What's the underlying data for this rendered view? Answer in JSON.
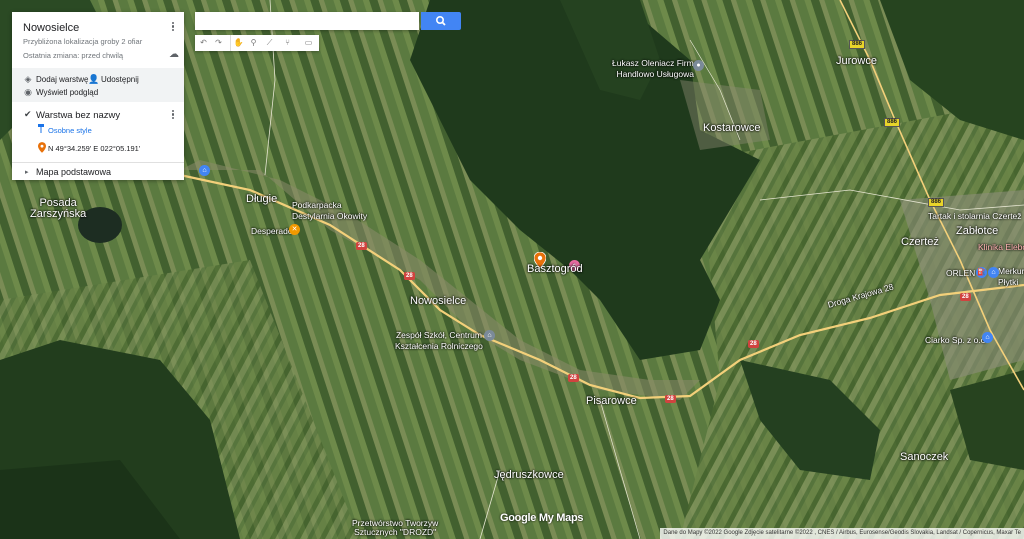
{
  "panel": {
    "title": "Nowosielce",
    "description": "Przybliżona lokalizacja groby 2 ofiar",
    "last_change": "Ostatnia zmiana: przed chwilą",
    "add_layer": "Dodaj warstwę",
    "share": "Udostępnij",
    "preview": "Wyświetl podgląd",
    "layer_name": "Warstwa bez nazwy",
    "layer_style": "Osobne style",
    "point_coords": "N 49°34.259' E 022°05.191'",
    "base_map": "Mapa podstawowa"
  },
  "search": {
    "value": "",
    "placeholder": ""
  },
  "map": {
    "marker_label": "Basztogród",
    "places": [
      {
        "name": "Posada\nZarszyńska",
        "kind": "town"
      },
      {
        "name": "Długie",
        "kind": "town"
      },
      {
        "name": "Podkarpacka\nDestylarnia Okowity",
        "kind": "poi"
      },
      {
        "name": "Desperado",
        "kind": "poi"
      },
      {
        "name": "Nowosielce",
        "kind": "town"
      },
      {
        "name": "Zespół Szkół, Centrum\nKształcenia Rolniczego",
        "kind": "poi"
      },
      {
        "name": "Pisarowce",
        "kind": "town"
      },
      {
        "name": "Jędruszkowce",
        "kind": "town"
      },
      {
        "name": "Przetwórstwo Tworzyw\nSztucznych \"DROZD\"",
        "kind": "poi"
      },
      {
        "name": "Łukasz Oleniacz Firma\nHandlowo Usługowa",
        "kind": "poi"
      },
      {
        "name": "Kostarowce",
        "kind": "town"
      },
      {
        "name": "Jurowce",
        "kind": "town"
      },
      {
        "name": "Tartak i stolarnia Czertež",
        "kind": "poi"
      },
      {
        "name": "Czerteż",
        "kind": "town"
      },
      {
        "name": "Zabłotce",
        "kind": "town"
      },
      {
        "name": "Klinika Elebo",
        "kind": "poi"
      },
      {
        "name": "ORLEN",
        "kind": "poi"
      },
      {
        "name": "Merkury\nPłytki",
        "kind": "poi"
      },
      {
        "name": "Ciarko Sp. z o.o",
        "kind": "poi"
      },
      {
        "name": "Sanoczek",
        "kind": "town"
      },
      {
        "name": "Droga Krajowa 28",
        "kind": "road"
      }
    ],
    "road_numbers": [
      "28",
      "28",
      "28",
      "28",
      "28",
      "28",
      "886",
      "886",
      "886"
    ],
    "logo": "Google My Maps",
    "attribution": "Dane do Mapy ©2022 Google Zdjęcie satelitarne ©2022 , CNES / Airbus, Eurosense/Geodis Slovakia, Landsat / Copernicus, Maxar Te"
  },
  "colors": {
    "accent": "#4285f4",
    "marker": "#e8710a",
    "road": "#f3d07a",
    "main_road": "#e9c46a"
  }
}
